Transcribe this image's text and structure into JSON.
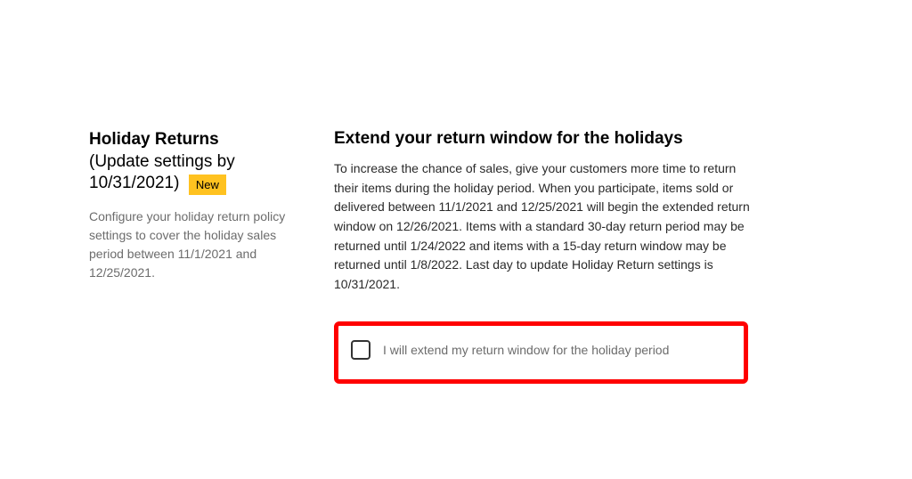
{
  "sidebar": {
    "title": "Holiday Returns",
    "subtitle": "(Update settings by 10/31/2021)",
    "badge": "New",
    "description": "Configure your holiday return policy settings to cover the holiday sales period between 11/1/2021 and 12/25/2021."
  },
  "main": {
    "title": "Extend your return window for the holidays",
    "description": "To increase the chance of sales, give your customers more time to return their items during the holiday period. When you participate, items sold or delivered between 11/1/2021 and 12/25/2021 will begin the extended return window on 12/26/2021. Items with a standard 30-day return period may be returned until 1/24/2022 and items with a 15-day return window may be returned until 1/8/2022. Last day to update Holiday Return settings is 10/31/2021.",
    "checkbox_label": "I will extend my return window for the holiday period"
  }
}
